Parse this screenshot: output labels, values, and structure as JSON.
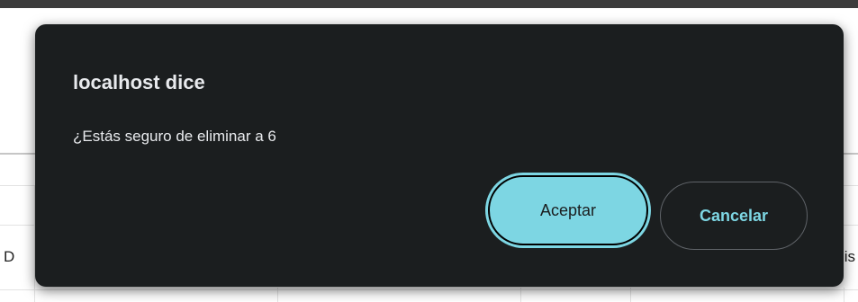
{
  "background": {
    "left_fragment": "D",
    "right_fragment": "lis"
  },
  "dialog": {
    "title": "localhost dice",
    "message": "¿Estás seguro de eliminar a 6",
    "accept_label": "Aceptar",
    "cancel_label": "Cancelar"
  },
  "colors": {
    "dialog_bg": "#1b1e1f",
    "accent": "#7dd6e3",
    "text": "#e8eaed"
  }
}
